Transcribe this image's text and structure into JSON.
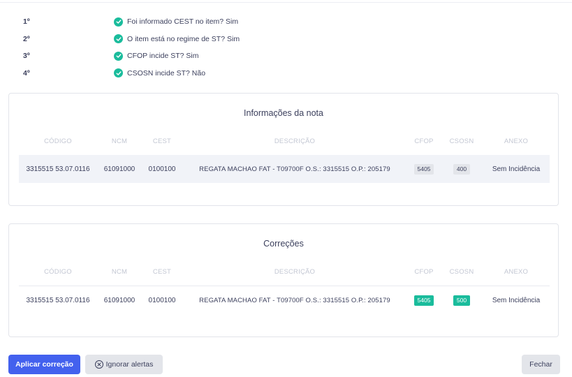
{
  "steps": [
    {
      "num": "1º",
      "text": "Foi informado CEST no item? Sim"
    },
    {
      "num": "2º",
      "text": "O item está no regime de ST? Sim"
    },
    {
      "num": "3º",
      "text": "CFOP incide ST? Sim"
    },
    {
      "num": "4º",
      "text": "CSOSN incide ST? Não"
    }
  ],
  "columns": {
    "codigo": "CÓDIGO",
    "ncm": "NCM",
    "cest": "CEST",
    "descricao": "DESCRIÇÃO",
    "cfop": "CFOP",
    "csosn": "CSOSN",
    "anexo": "ANEXO"
  },
  "nota": {
    "title": "Informações da nota",
    "row": {
      "codigo": "3315515 53.07.0116",
      "ncm": "61091000",
      "cest": "0100100",
      "descricao": "REGATA MACHAO FAT - T09700F O.S.: 3315515 O.P.: 205179",
      "cfop": "5405",
      "csosn": "400",
      "anexo": "Sem Incidência"
    }
  },
  "correcoes": {
    "title": "Correções",
    "row": {
      "codigo": "3315515 53.07.0116",
      "ncm": "61091000",
      "cest": "0100100",
      "descricao": "REGATA MACHAO FAT - T09700F O.S.: 3315515 O.P.: 205179",
      "cfop": "5405",
      "csosn": "500",
      "anexo": "Sem Incidência"
    }
  },
  "buttons": {
    "apply": "Aplicar correção",
    "ignore": "Ignorar alertas",
    "close": "Fechar"
  },
  "colors": {
    "primary": "#4361ee",
    "success": "#1abc9c",
    "neutral": "#e3e5ea"
  }
}
